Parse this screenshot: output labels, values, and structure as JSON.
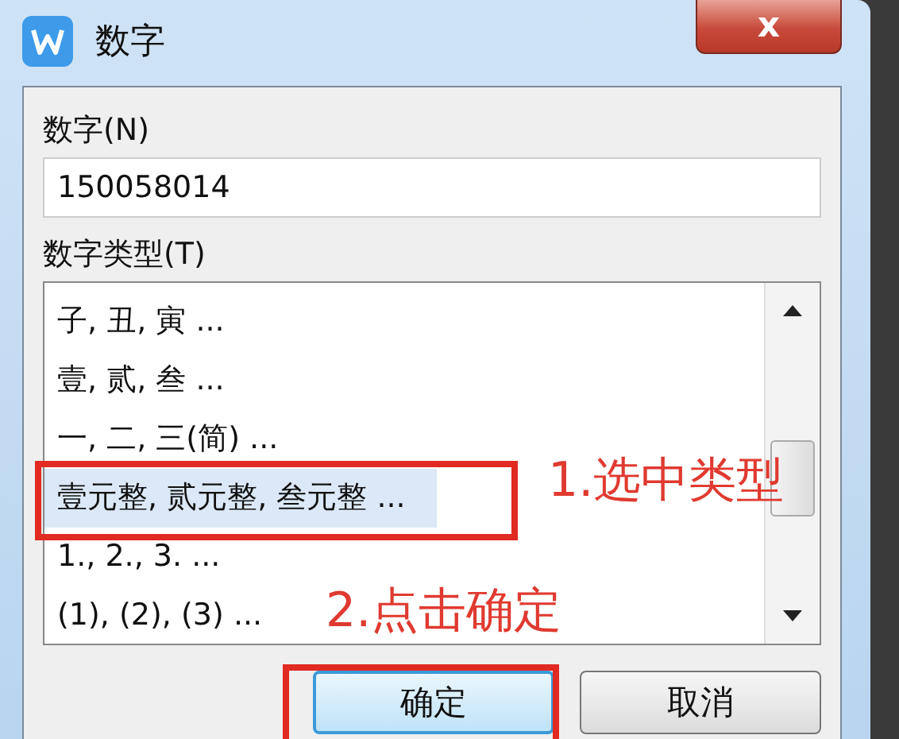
{
  "window": {
    "title": "数字",
    "close": "x"
  },
  "number_field": {
    "label": "数字(N)",
    "value": "150058014"
  },
  "type_list": {
    "label": "数字类型(T)",
    "items": [
      {
        "text": "子, 丑, 寅 ...",
        "selected": false
      },
      {
        "text": "壹, 贰, 叁 ...",
        "selected": false
      },
      {
        "text": "一, 二, 三(简) ...",
        "selected": false
      },
      {
        "text": "壹元整, 贰元整, 叁元整 ...",
        "selected": true
      },
      {
        "text": "1., 2., 3. ...",
        "selected": false
      },
      {
        "text": "(1), (2), (3) ...",
        "selected": false
      }
    ]
  },
  "buttons": [
    {
      "label": "确定",
      "kind": "default"
    },
    {
      "label": "取消",
      "kind": "normal"
    }
  ],
  "annotations": [
    "1.选中类型",
    "2.点击确定"
  ]
}
